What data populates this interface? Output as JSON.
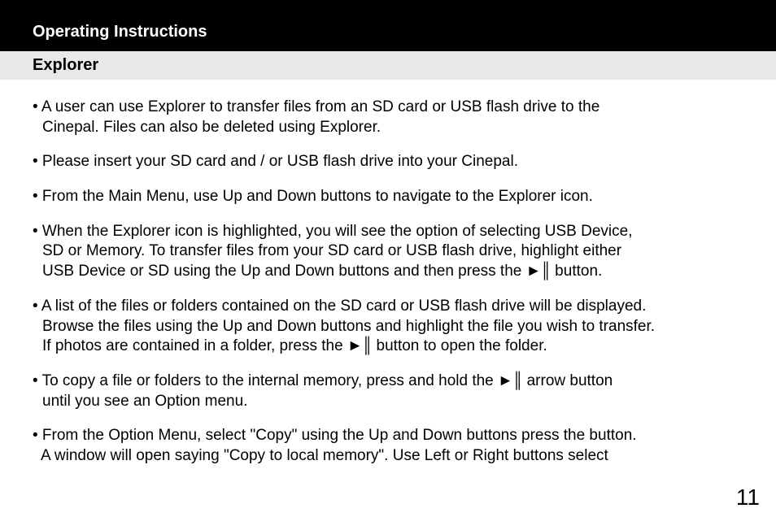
{
  "header_black": "Operating Instructions",
  "header_gray": "Explorer",
  "play_pause": "►║",
  "bullets": {
    "b1_l1": "• A user can use Explorer to transfer files from an SD card or USB flash drive to the",
    "b1_l2": "Cinepal. Files can also be deleted using Explorer.",
    "b2_l1": "• Please insert your SD card and / or USB flash drive into your Cinepal.",
    "b3_l1": "• From the Main Menu, use Up and Down buttons to navigate to the Explorer icon.",
    "b4_l1": "• When the Explorer icon is highlighted, you will see the option of selecting USB Device,",
    "b4_l2": "SD or Memory. To transfer files from your SD card or USB flash drive, highlight either",
    "b4_l3a": "USB Device or SD using the Up and Down buttons and then press the  ",
    "b4_l3b": "  button.",
    "b5_l1": "• A list of the files or folders contained on the SD card or USB flash drive will be displayed.",
    "b5_l2": "Browse the files using the Up and Down buttons and highlight the file you wish to transfer.",
    "b5_l3a": "If photos are contained in a folder, press the  ",
    "b5_l3b": "  button to open the folder.",
    "b6_l1a": "• To copy a file or folders to the internal memory, press and hold the  ",
    "b6_l1b": "  arrow button",
    "b6_l2": "until you see an Option menu.",
    "b7_l1": "• From the Option Menu, select \"Copy\" using the Up and Down buttons press the button.",
    "b7_l2": "A window will open saying \"Copy to local memory\". Use Left or Right buttons select"
  },
  "page_number": "11"
}
